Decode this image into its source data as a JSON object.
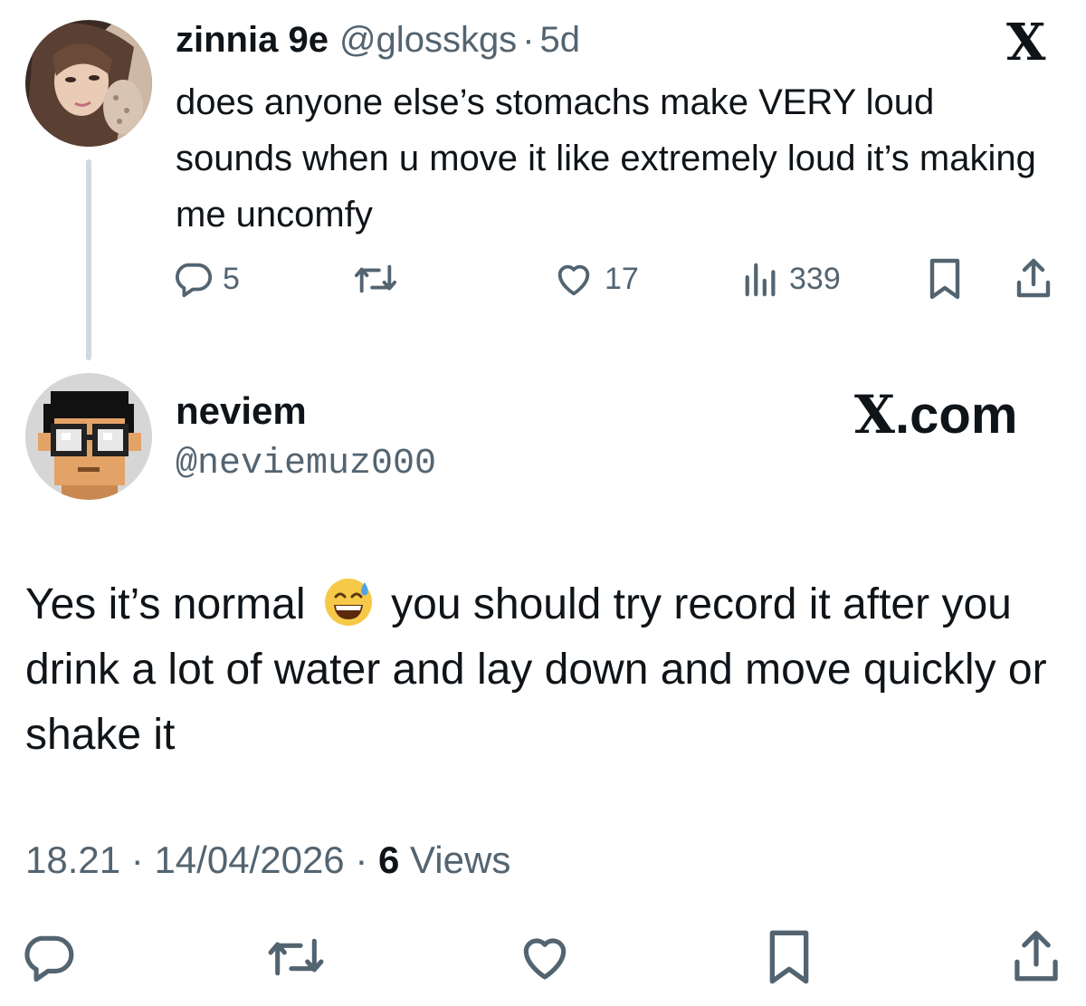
{
  "original_tweet": {
    "display_name": "zinnia 9e",
    "handle": "@glosskgs",
    "separator": "·",
    "time_ago": "5d",
    "text": "does anyone else’s stomachs make VERY loud sounds when u move it like extremely loud it’s making me uncomfy",
    "actions": {
      "reply_count": "5",
      "retweet_count": "",
      "like_count": "17",
      "views_count": "339"
    },
    "icons": [
      "reply-icon",
      "retweet-icon",
      "like-icon",
      "views-icon",
      "bookmark-icon",
      "share-icon"
    ]
  },
  "x_logo_glyph": "X",
  "reply_tweet": {
    "display_name": "neviem",
    "handle": "@neviemuz000",
    "brand_glyph": "X",
    "brand_text": ".com",
    "text_before_emoji": "Yes it’s normal ",
    "text_after_emoji": " you should try record it after you drink a lot of water and lay down and move quickly or shake it",
    "emoji_name": "grinning-face-with-sweat",
    "time": "18.21",
    "separator": "·",
    "date": "14/04/2026",
    "views_count": "6",
    "views_label": " Views",
    "icons": [
      "reply-icon",
      "retweet-icon",
      "like-icon",
      "bookmark-icon",
      "share-icon"
    ]
  },
  "colors": {
    "text": "#0f1419",
    "secondary": "#536471",
    "thread_line": "#cfd9de"
  }
}
